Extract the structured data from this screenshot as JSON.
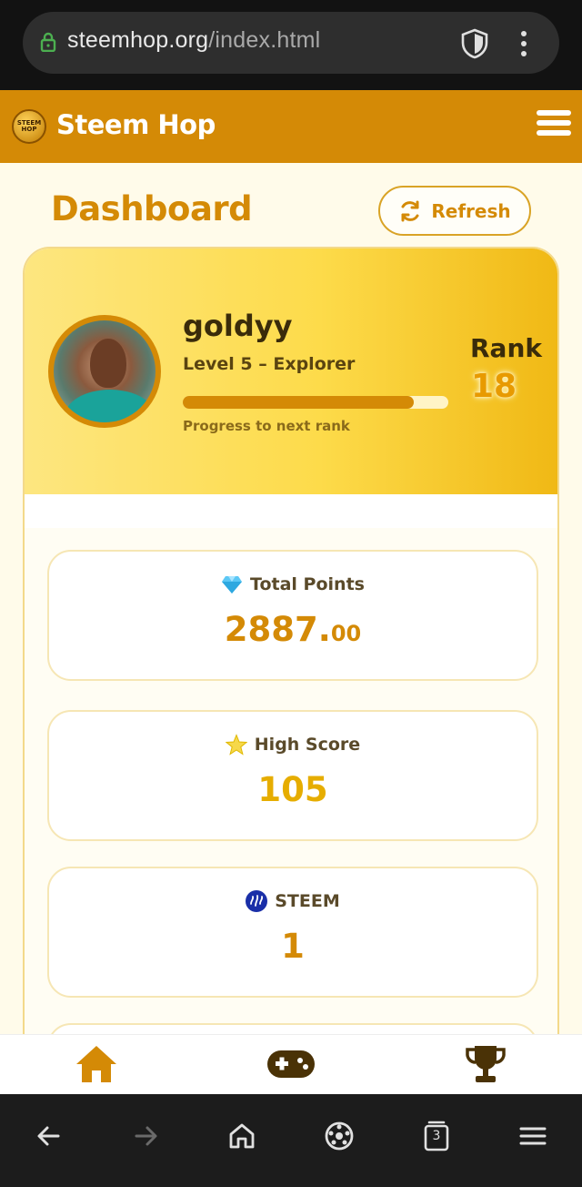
{
  "browser": {
    "url_host": "steemhop.org",
    "url_path": "/index.html",
    "tab_count": "3"
  },
  "app": {
    "brand": "Steem Hop",
    "logo_text": "STEEM HOP"
  },
  "dashboard": {
    "title": "Dashboard",
    "refresh_label": "Refresh"
  },
  "profile": {
    "username": "goldyy",
    "level": "Level 5 – Explorer",
    "progress_label": "Progress to next rank",
    "progress_fraction": 0.87,
    "rank_label": "Rank",
    "rank_value": "18"
  },
  "stats": {
    "total_points": {
      "label": "Total Points",
      "value_int": "2887.",
      "value_dec": "00",
      "icon": "diamond-icon"
    },
    "high_score": {
      "label": "High Score",
      "value": "105",
      "icon": "star-icon"
    },
    "steem": {
      "label": "STEEM",
      "value": "1",
      "icon": "steem-logo-icon"
    }
  },
  "nav": {
    "items": [
      "home-icon",
      "gamepad-icon",
      "trophy-icon"
    ]
  },
  "colors": {
    "accent": "#d48a06",
    "header_bg": "#d48a06",
    "profile_gradient_start": "#fde680",
    "profile_gradient_end": "#f0b814",
    "rank_value": "#e89a00"
  }
}
